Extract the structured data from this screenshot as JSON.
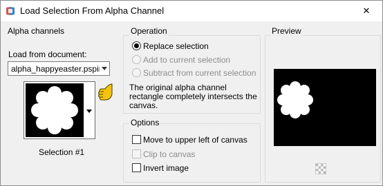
{
  "window": {
    "title": "Load Selection From Alpha Channel",
    "close_glyph": "✕"
  },
  "alpha_channels": {
    "title": "Alpha channels",
    "load_label": "Load from document:",
    "document_value": "alpha_happyeaster.pspimage",
    "selection_caption": "Selection #1"
  },
  "operation": {
    "title": "Operation",
    "options": [
      {
        "label": "Replace selection",
        "selected": true,
        "enabled": true
      },
      {
        "label": "Add to current selection",
        "selected": false,
        "enabled": false
      },
      {
        "label": "Subtract from current selection",
        "selected": false,
        "enabled": false
      }
    ],
    "note_lines": [
      "The original alpha channel",
      "rectangle completely intersects the",
      "canvas."
    ]
  },
  "options": {
    "title": "Options",
    "checkboxes": [
      {
        "label": "Move to upper left of canvas",
        "checked": false,
        "enabled": true
      },
      {
        "label": "Clip to canvas",
        "checked": false,
        "enabled": false
      },
      {
        "label": "Invert image",
        "checked": false,
        "enabled": true
      }
    ]
  },
  "preview": {
    "title": "Preview"
  },
  "icons": {
    "app": "paint-shop-pro-icon",
    "close": "close-icon",
    "dropdown": "chevron-down-icon",
    "hand": "pointing-hand-icon",
    "checker": "transparency-checker-icon"
  },
  "colors": {
    "selection_shape": "#ffffff",
    "alpha_background": "#000000",
    "pointer_hand": "#f2c40f"
  }
}
